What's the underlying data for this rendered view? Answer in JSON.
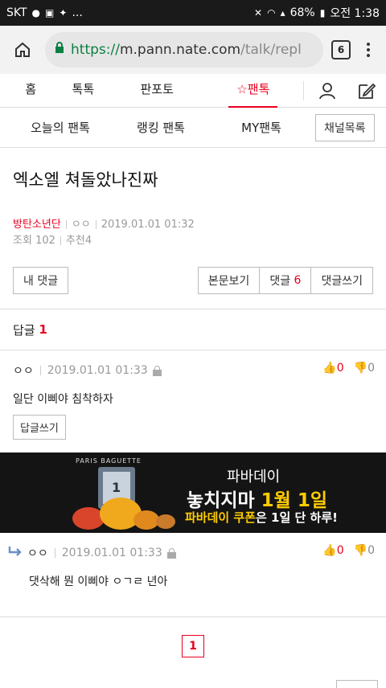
{
  "status": {
    "carrier": "SKT",
    "battery": "68%",
    "time": "오전 1:38",
    "extra": "..."
  },
  "browser": {
    "url_scheme": "https://",
    "url_host": "m.pann.nate.com",
    "url_path": "/talk/repl",
    "tab_count": "6"
  },
  "gnb": {
    "items": [
      "홈",
      "톡톡",
      "판포토",
      "팬톡"
    ]
  },
  "subnav": {
    "items": [
      "오늘의 팬톡",
      "랭킹 팬톡",
      "MY팬톡"
    ],
    "channel_button": "채널목록"
  },
  "post": {
    "title": "엑소엘 쳐돌았나진짜",
    "category": "방탄소년단",
    "author": "ㅇㅇ",
    "datetime": "2019.01.01 01:32",
    "views_label": "조회",
    "views": "102",
    "recommend_label": "추천",
    "recommend": "4"
  },
  "buttons": {
    "my_comments": "내 댓글",
    "view_post": "본문보기",
    "comments_label": "댓글",
    "comments_count": "6",
    "write_comment": "댓글쓰기"
  },
  "replies": {
    "label": "답글",
    "count": "1"
  },
  "comment": {
    "nick": "ㅇㅇ",
    "datetime": "2019.01.01 01:33",
    "up": "0",
    "down": "0",
    "body": "일단 이삐야 침착하자",
    "reply_button": "답글쓰기"
  },
  "banner": {
    "brand": "PARIS BAGUETTE",
    "line1": "파바데이",
    "line2_a": "놓치지마",
    "line2_b": "1월 1일",
    "line3_a": "파바데이 쿠폰",
    "line3_b": "은 1일 단 하루!",
    "badge": "1"
  },
  "subcomment": {
    "nick": "ㅇㅇ",
    "datetime": "2019.01.01 01:33",
    "up": "0",
    "down": "0",
    "body": "댓삭해 뭔 이삐야 ㅇㄱㄹ 년아"
  },
  "pager": {
    "current": "1"
  },
  "colors": {
    "accent": "#e8001f",
    "url_green": "#0b8043"
  }
}
